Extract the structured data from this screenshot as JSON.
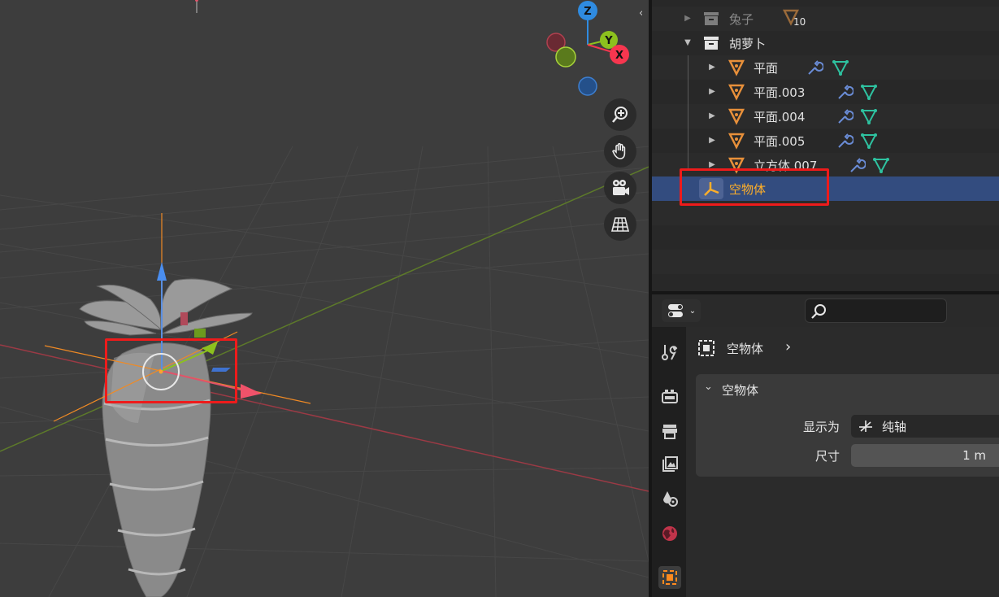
{
  "outliner": {
    "rows": [
      {
        "label": "兔子",
        "count": "10"
      },
      {
        "label": "胡萝卜"
      },
      {
        "label": "平面"
      },
      {
        "label": "平面.003"
      },
      {
        "label": "平面.004"
      },
      {
        "label": "平面.005"
      },
      {
        "label": "立方体.007"
      },
      {
        "label": "空物体"
      }
    ]
  },
  "properties": {
    "breadcrumb": "空物体",
    "panel_title": "空物体",
    "display_as_label": "显示为",
    "display_as_value": "纯轴",
    "size_label": "尺寸",
    "size_value": "1 m"
  },
  "gizmo": {
    "z": "Z",
    "y": "Y",
    "x": "X"
  },
  "colors": {
    "selection_blue": "#334c7f",
    "active_orange": "#ffaf29",
    "highlight_red": "#ee1b1b",
    "axis_x": "#f7364f",
    "axis_y": "#8cc11e",
    "axis_z": "#2f8be0"
  }
}
